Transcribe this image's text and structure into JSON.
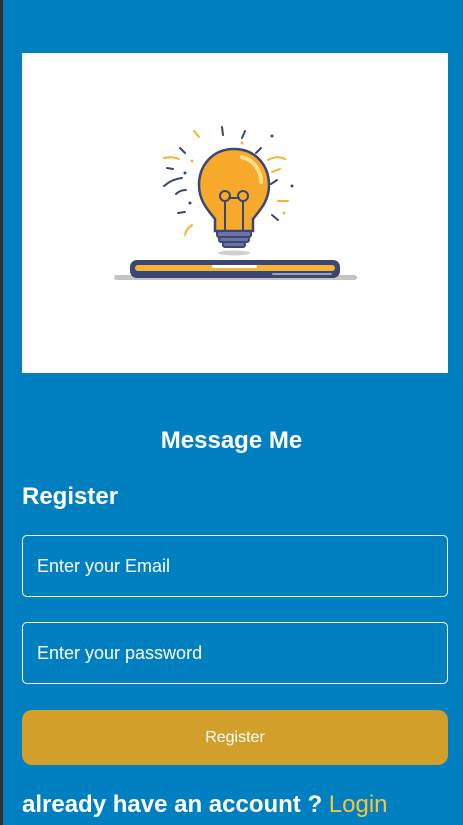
{
  "colors": {
    "background": "#0180c1",
    "button": "#d2a02a",
    "link": "#f3c63b",
    "bulb": "#f6a92a",
    "laptop": "#3b4672"
  },
  "hero": {
    "illustration": "lightbulb-on-laptop"
  },
  "app_title": "Message Me",
  "form": {
    "title": "Register",
    "email_placeholder": "Enter your Email",
    "password_placeholder": "Enter your password",
    "submit_label": "Register"
  },
  "footer": {
    "prompt": "already have an account ?",
    "link_label": "Login"
  }
}
